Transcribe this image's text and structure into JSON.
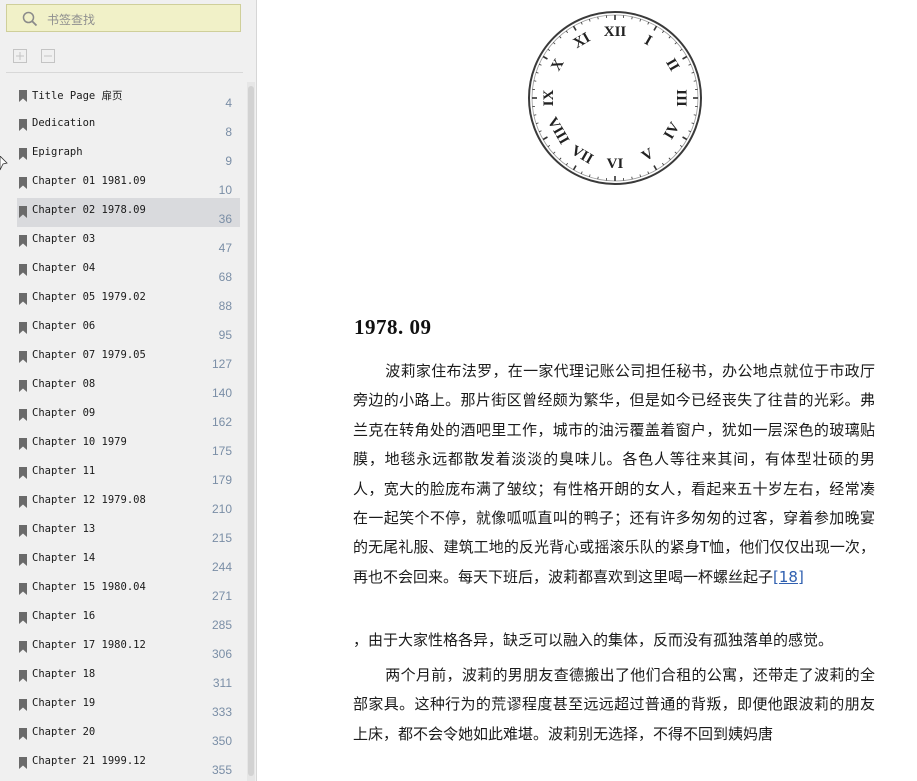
{
  "sidebar": {
    "search_placeholder": "书签查找",
    "selected_index": 4,
    "items": [
      {
        "label": "Title Page 扉页",
        "page": "4"
      },
      {
        "label": "Dedication",
        "page": "8"
      },
      {
        "label": "Epigraph",
        "page": "9"
      },
      {
        "label": "Chapter 01 1981.09",
        "page": "10"
      },
      {
        "label": "Chapter 02 1978.09",
        "page": "36"
      },
      {
        "label": "Chapter 03",
        "page": "47"
      },
      {
        "label": "Chapter 04",
        "page": "68"
      },
      {
        "label": "Chapter 05 1979.02",
        "page": "88"
      },
      {
        "label": "Chapter 06",
        "page": "95"
      },
      {
        "label": "Chapter 07 1979.05",
        "page": "127"
      },
      {
        "label": "Chapter 08",
        "page": "140"
      },
      {
        "label": "Chapter 09",
        "page": "162"
      },
      {
        "label": "Chapter 10 1979",
        "page": "175"
      },
      {
        "label": "Chapter 11",
        "page": "179"
      },
      {
        "label": "Chapter 12 1979.08",
        "page": "210"
      },
      {
        "label": "Chapter 13",
        "page": "215"
      },
      {
        "label": "Chapter 14",
        "page": "244"
      },
      {
        "label": "Chapter 15 1980.04",
        "page": "271"
      },
      {
        "label": "Chapter 16",
        "page": "285"
      },
      {
        "label": "Chapter 17 1980.12",
        "page": "306"
      },
      {
        "label": "Chapter 18",
        "page": "311"
      },
      {
        "label": "Chapter 19",
        "page": "333"
      },
      {
        "label": "Chapter 20",
        "page": "350"
      },
      {
        "label": "Chapter 21 1999.12",
        "page": "355"
      }
    ]
  },
  "clock": {
    "numerals": [
      "XII",
      "I",
      "II",
      "III",
      "IV",
      "V",
      "VI",
      "VII",
      "VIII",
      "IX",
      "X",
      "XI"
    ]
  },
  "content": {
    "chapter_title": "1978. 09",
    "para1": "波莉家住布法罗，在一家代理记账公司担任秘书，办公地点就位于市政厅旁边的小路上。那片街区曾经颇为繁华，但是如今已经丧失了往昔的光彩。弗兰克在转角处的酒吧里工作，城市的油污覆盖着窗户，犹如一层深色的玻璃贴膜，地毯永远都散发着淡淡的臭味儿。各色人等往来其间，有体型壮硕的男人，宽大的脸庞布满了皱纹；有性格开朗的女人，看起来五十岁左右，经常凑在一起笑个不停，就像呱呱直叫的鸭子；还有许多匆匆的过客，穿着参加晚宴的无尾礼服、建筑工地的反光背心或摇滚乐队的紧身T恤，他们仅仅出现一次，再也不会回来。每天下班后，波莉都喜欢到这里喝一杯螺丝起子",
    "footnote": "[18]",
    "para1_cont": "，由于大家性格各异，缺乏可以融入的集体，反而没有孤独落单的感觉。",
    "para2": "两个月前，波莉的男朋友查德搬出了他们合租的公寓，还带走了波莉的全部家具。这种行为的荒谬程度甚至远远超过普通的背叛，即便他跟波莉的朋友上床，都不会令她如此难堪。波莉别无选择，不得不回到姨妈唐"
  }
}
